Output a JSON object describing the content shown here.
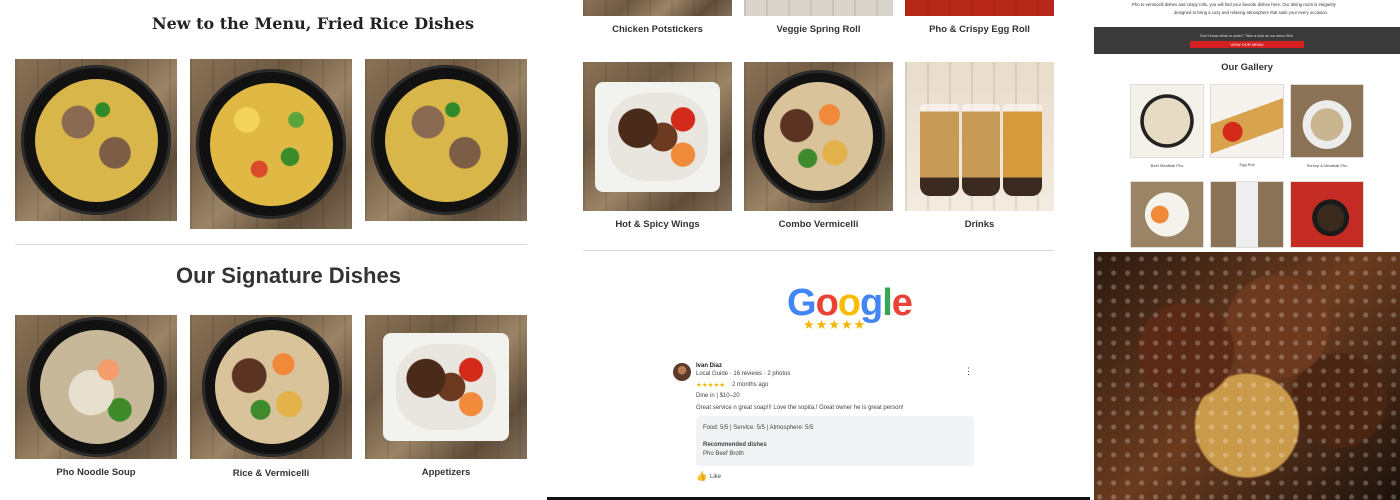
{
  "panel1": {
    "menu_title": "New to the Menu, Fried Rice Dishes",
    "signature_title": "Our Signature Dishes",
    "signature_items": [
      {
        "label": "Pho Noodle Soup"
      },
      {
        "label": "Rice & Vermicelli"
      },
      {
        "label": "Appetizers"
      }
    ]
  },
  "panel2": {
    "top_items": [
      {
        "label": "Chicken Potstickers"
      },
      {
        "label": "Veggie Spring Roll"
      },
      {
        "label": "Pho & Crispy Egg Roll"
      }
    ],
    "mid_items": [
      {
        "label": "Hot & Spicy Wings"
      },
      {
        "label": "Combo Vermicelli"
      },
      {
        "label": "Drinks"
      }
    ],
    "google_logo": "Google",
    "google_stars": "★★★★★",
    "review": {
      "name": "Ivan Diaz",
      "meta": "Local Guide · 16 reviews · 2 photos",
      "stars": "★★★★★",
      "time": "2 months ago",
      "dine": "Dine in  |  $10–20",
      "text": "Great service n great soap!!! Love the sopita,! Great owner he is great person!",
      "food": "Food: 5/5  |  Service: 5/5  |  Atmosphere: 5/5",
      "recommended_label": "Recommended dishes",
      "recommended_value": "Pho Beef Broth",
      "like": "Like",
      "more": "⋮",
      "like_icon": "👍"
    }
  },
  "panel3": {
    "intro_line1": "Pho to vermicelli dishes and crispy rolls, you will find your favorite dishes here. Our dining room is elegantly",
    "intro_line2": "designed to bring a cozy and relaxing atmosphere that suits your every occasion.",
    "cta_text": "Don't know what to order? Take a look at our menu first",
    "cta_button": "VIEW OUR MENU",
    "gallery_title": "Our Gallery",
    "gallery_captions": [
      "Beef Meatball Pho",
      "Egg Roll",
      "Shrimp & Meatball Pho"
    ]
  }
}
